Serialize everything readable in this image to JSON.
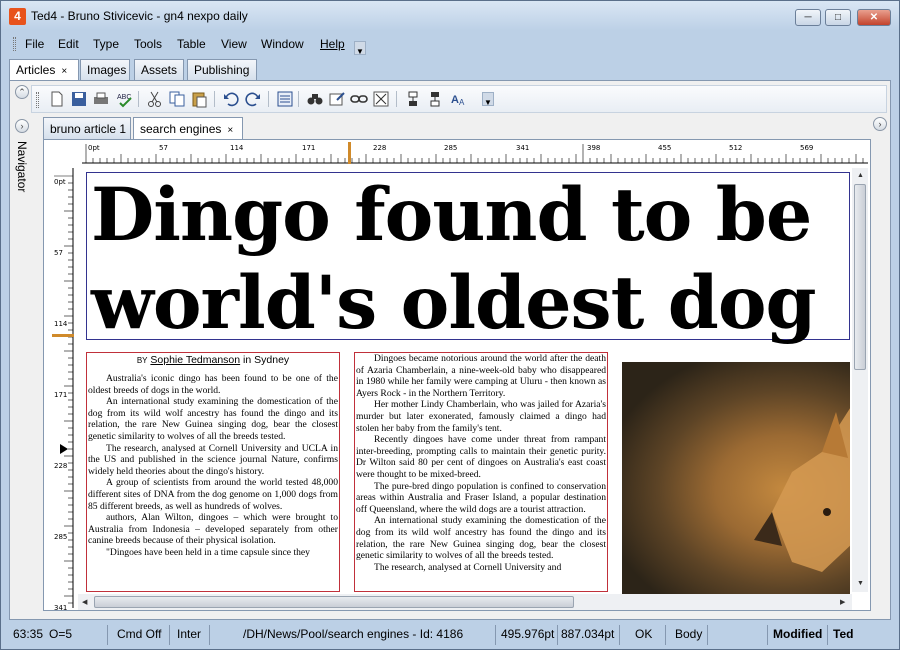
{
  "window": {
    "app_icon": "4",
    "title": "Ted4 - Bruno Stivicevic - gn4 nexpo daily"
  },
  "menu": [
    "File",
    "Edit",
    "Type",
    "Tools",
    "Table",
    "View",
    "Window",
    "Help"
  ],
  "top_tabs": [
    {
      "label": "Articles",
      "active": true,
      "closable": true
    },
    {
      "label": "Images"
    },
    {
      "label": "Assets"
    },
    {
      "label": "Publishing"
    }
  ],
  "toolbar_icons": [
    "new-document-icon",
    "save-icon",
    "print-icon",
    "spellcheck-icon",
    "cut-icon",
    "copy-icon",
    "paste-icon",
    "undo-icon",
    "redo-icon",
    "layout-icon",
    "find-icon",
    "properties-icon",
    "link-icon",
    "settings-icon",
    "insert-before-icon",
    "insert-after-icon",
    "text-style-icon"
  ],
  "navigator_label": "Navigator",
  "doc_tabs": [
    {
      "label": "bruno article 1"
    },
    {
      "label": "search engines",
      "active": true,
      "closable": true
    }
  ],
  "hruler_labels": [
    "0pt",
    "57",
    "114",
    "171",
    "228",
    "285",
    "341",
    "398",
    "455",
    "512",
    "569"
  ],
  "vruler_labels": [
    "0pt",
    "57",
    "114",
    "171",
    "228",
    "285",
    "341"
  ],
  "article": {
    "headline_line1": "Dingo found to be",
    "headline_line2": "world's oldest dog",
    "byline_by": "BY",
    "byline_name": "Sophie Tedmanson",
    "byline_place": "in Sydney",
    "col1": [
      "Australia's iconic dingo has been found to be one of the oldest breeds of dogs in the world.",
      "An international study examining the domestication of the dog from its wild wolf ancestry has found the dingo and its relation, the rare New Guinea singing dog, bear the closest genetic similarity to wolves of all the breeds tested.",
      "The research, analysed at Cornell University and UCLA in the US and published in the science journal Nature, confirms widely held theories about the dingo's history.",
      "A group of scientists from around the world tested 48,000 different sites of DNA from the dog genome on 1,000 dogs from 85 different breeds, as well as hundreds of wolves.",
      "authors, Alan Wilton, dingoes – which were brought to Australia from Indonesia – developed separately from other canine breeds because of their physical isolation.",
      "\"Dingoes have been held in a time capsule since they"
    ],
    "col2": [
      "Dingoes became notorious around the world after the death of Azaria Chamberlain, a nine-week-old baby who disappeared in 1980 while her family were camping at Uluru - then known as Ayers Rock - in the Northern Territory.",
      "Her mother Lindy Chamberlain, who was jailed for Azaria's murder but later exonerated, famously claimed a dingo had stolen her baby from the family's tent.",
      "Recently dingoes have come under threat from rampant inter-breeding, prompting calls to maintain their genetic purity. Dr Wilton said 80 per cent of dingoes on Australia's east coast were thought to be mixed-breed.",
      "The pure-bred dingo population is confined to conservation areas within Australia and Fraser Island, a popular destination off Queensland, where the wild dogs are a tourist attraction.",
      "An international study examining the domestication of the dog from its wild wolf ancestry has found the dingo and its relation, the rare New Guinea singing dog, bear the closest genetic similarity to wolves of all the breeds tested.",
      "The research, analysed at Cornell University and"
    ]
  },
  "status": {
    "position": "63:35",
    "offset": "O=5",
    "cmd": "Cmd Off",
    "mode": "Inter",
    "path": "/DH/News/Pool/search engines - Id: 4186",
    "x_pos": "495.976pt",
    "y_pos": "887.034pt",
    "ok": "OK",
    "style": "Body",
    "modified": "Modified",
    "user": "Ted"
  }
}
